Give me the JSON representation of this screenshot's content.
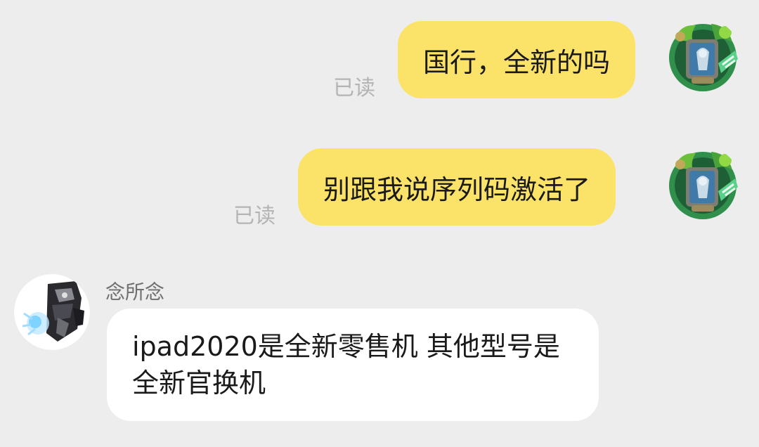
{
  "chat": {
    "messages": [
      {
        "direction": "outgoing",
        "text": "国行，全新的吗",
        "status": "已读",
        "avatar_icon": "hearthstone-hero-portrait"
      },
      {
        "direction": "outgoing",
        "text": "别跟我说序列码激活了",
        "status": "已读",
        "avatar_icon": "hearthstone-hero-portrait"
      },
      {
        "direction": "incoming",
        "sender": "念所念",
        "text": "ipad2020是全新零售机  其他型号是全新官换机",
        "avatar_icon": "robot-character-portrait"
      }
    ]
  },
  "colors": {
    "background": "#ededed",
    "outgoing_bubble": "#fbe269",
    "incoming_bubble": "#ffffff",
    "read_status": "#b4b4b4"
  }
}
